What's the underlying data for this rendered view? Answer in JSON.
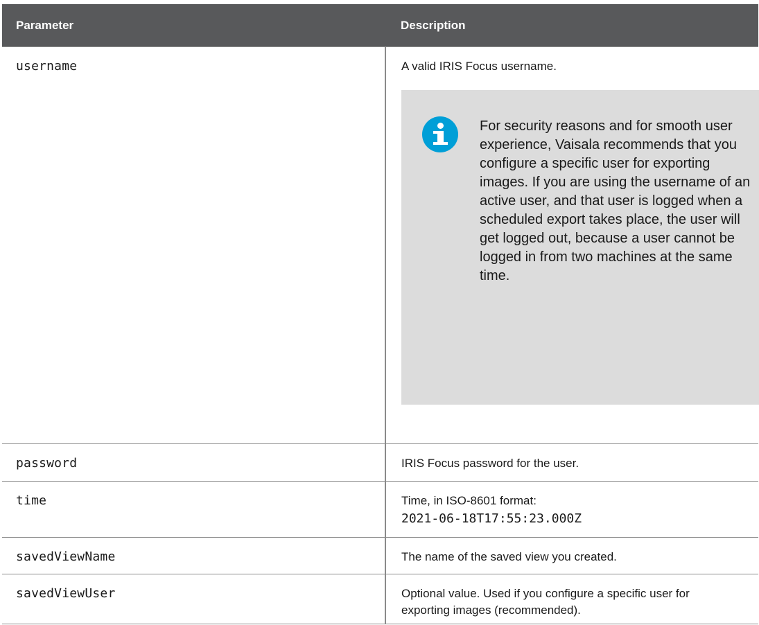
{
  "table": {
    "headers": {
      "parameter": "Parameter",
      "description": "Description"
    },
    "rows": [
      {
        "param": "username",
        "description": "A valid IRIS Focus username."
      },
      {
        "param": "password",
        "description": "IRIS Focus password for the user."
      },
      {
        "param": "time",
        "description": "Time, in ISO-8601 format:",
        "code": "2021-06-18T17:55:23.000Z"
      },
      {
        "param": "savedViewName",
        "description": "The name of the saved view you created."
      },
      {
        "param": "savedViewUser",
        "description": "Optional value. Used if you configure a specific user for exporting images (recommended)."
      }
    ],
    "note": {
      "icon": "info-icon",
      "icon_color": "#009fd7",
      "text": "For security reasons and for smooth user experience, Vaisala recommends that you configure a specific user for exporting images. If you are using the username of an active user, and that user is logged when a scheduled export takes place, the user will get logged out, because a user cannot be logged in from two machines at the same time."
    }
  },
  "colors": {
    "header_bg": "#58595b",
    "note_bg": "#dcdcdc",
    "border": "#8a8a8a"
  }
}
